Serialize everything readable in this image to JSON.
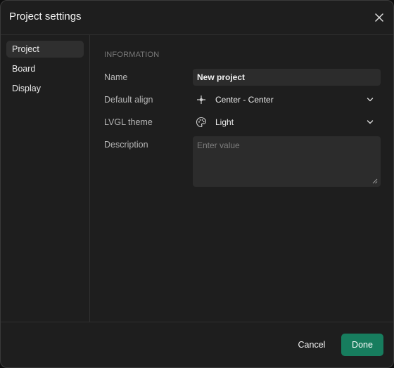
{
  "dialog": {
    "title": "Project settings",
    "close_icon": "close-icon"
  },
  "sidebar": {
    "items": [
      {
        "label": "Project",
        "active": true
      },
      {
        "label": "Board",
        "active": false
      },
      {
        "label": "Display",
        "active": false
      }
    ]
  },
  "content": {
    "section_title": "INFORMATION",
    "name": {
      "label": "Name",
      "value": "New project"
    },
    "default_align": {
      "label": "Default align",
      "value": "Center - Center",
      "icon": "align-center-icon"
    },
    "lvgl_theme": {
      "label": "LVGL theme",
      "value": "Light",
      "icon": "palette-icon"
    },
    "description": {
      "label": "Description",
      "placeholder": "Enter value",
      "value": ""
    }
  },
  "footer": {
    "cancel_label": "Cancel",
    "done_label": "Done"
  },
  "colors": {
    "background": "#1e1e1e",
    "input_background": "#2c2c2c",
    "accent": "#177d5e",
    "active_nav": "#2f2f2f"
  }
}
